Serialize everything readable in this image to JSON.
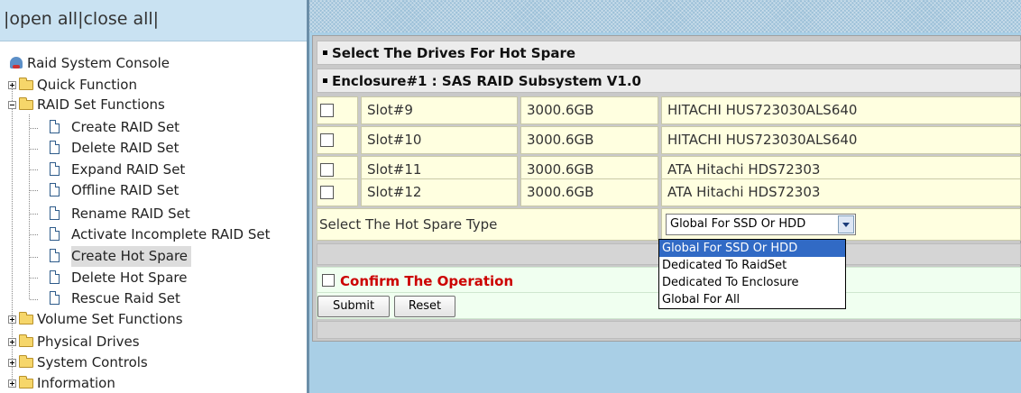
{
  "tree": {
    "open_all": "open all",
    "close_all": "close all",
    "separator": "|",
    "root": "Raid System Console",
    "items": [
      {
        "label": "Quick Function"
      },
      {
        "label": "RAID Set Functions"
      },
      {
        "label": "Create RAID Set"
      },
      {
        "label": "Delete RAID Set"
      },
      {
        "label": "Expand RAID Set"
      },
      {
        "label": "Offline RAID Set"
      },
      {
        "label": "Rename RAID Set"
      },
      {
        "label": "Activate Incomplete RAID Set"
      },
      {
        "label": "Create Hot Spare"
      },
      {
        "label": "Delete Hot Spare"
      },
      {
        "label": "Rescue Raid Set"
      },
      {
        "label": "Volume Set Functions"
      },
      {
        "label": "Physical Drives"
      },
      {
        "label": "System Controls"
      },
      {
        "label": "Information"
      }
    ]
  },
  "main": {
    "section_title": "Select The Drives For Hot Spare",
    "enclosure_title": "Enclosure#1 : SAS RAID Subsystem V1.0",
    "drives": [
      {
        "slot": "Slot#9",
        "size": "3000.6GB",
        "model": "HITACHI HUS723030ALS640"
      },
      {
        "slot": "Slot#10",
        "size": "3000.6GB",
        "model": "HITACHI HUS723030ALS640"
      },
      {
        "slot": "Slot#11",
        "size": "3000.6GB",
        "model": "ATA Hitachi HDS72303"
      },
      {
        "slot": "Slot#12",
        "size": "3000.6GB",
        "model": "ATA Hitachi HDS72303"
      }
    ],
    "hot_spare_type_label": "Select The Hot Spare Type",
    "hot_spare_type_value": "Global For SSD Or HDD",
    "hot_spare_options": [
      "Global For SSD Or HDD",
      "Dedicated To RaidSet",
      "Dedicated To Enclosure",
      "Global For All"
    ],
    "confirm_label": "Confirm The Operation",
    "submit_label": "Submit",
    "reset_label": "Reset"
  }
}
